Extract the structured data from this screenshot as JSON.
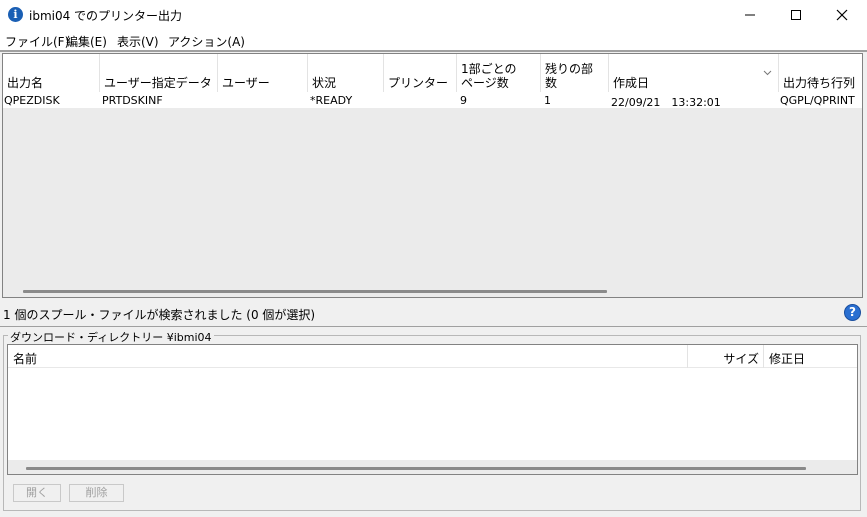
{
  "window": {
    "title": "ibmi04 でのプリンター出力"
  },
  "menu": [
    "ファイル(F)",
    "編集(E)",
    "表示(V)",
    "アクション(A)"
  ],
  "table": {
    "columns": [
      "出力名",
      "ユーザー指定データ",
      "ユーザー",
      "状況",
      "プリンター",
      "1部ごとの\nページ数",
      "残りの部\n数",
      "作成日",
      "出力待ち行列"
    ],
    "rows": [
      {
        "output_name": "QPEZDISK",
        "user_data": "PRTDSKINF",
        "user": "",
        "status": "*READY",
        "printer": "",
        "pages": "9",
        "copies_left": "1",
        "created": "22/09/21　13:32:01",
        "queue": "QGPL/QPRINT"
      }
    ]
  },
  "status": {
    "text": "1 個のスプール・ファイルが検索されました (0 個が選択)"
  },
  "download": {
    "legend": "ダウンロード・ディレクトリー ¥ibmi04",
    "columns": [
      "名前",
      "サイズ",
      "修正日"
    ]
  },
  "buttons": {
    "open": "開く",
    "delete": "削除"
  },
  "colors": {
    "brand": "#1a5fb4",
    "help": "#2a6fd1"
  },
  "icons": {
    "app": "info-icon",
    "help": "help-icon",
    "sort": "chevron-down-icon"
  }
}
